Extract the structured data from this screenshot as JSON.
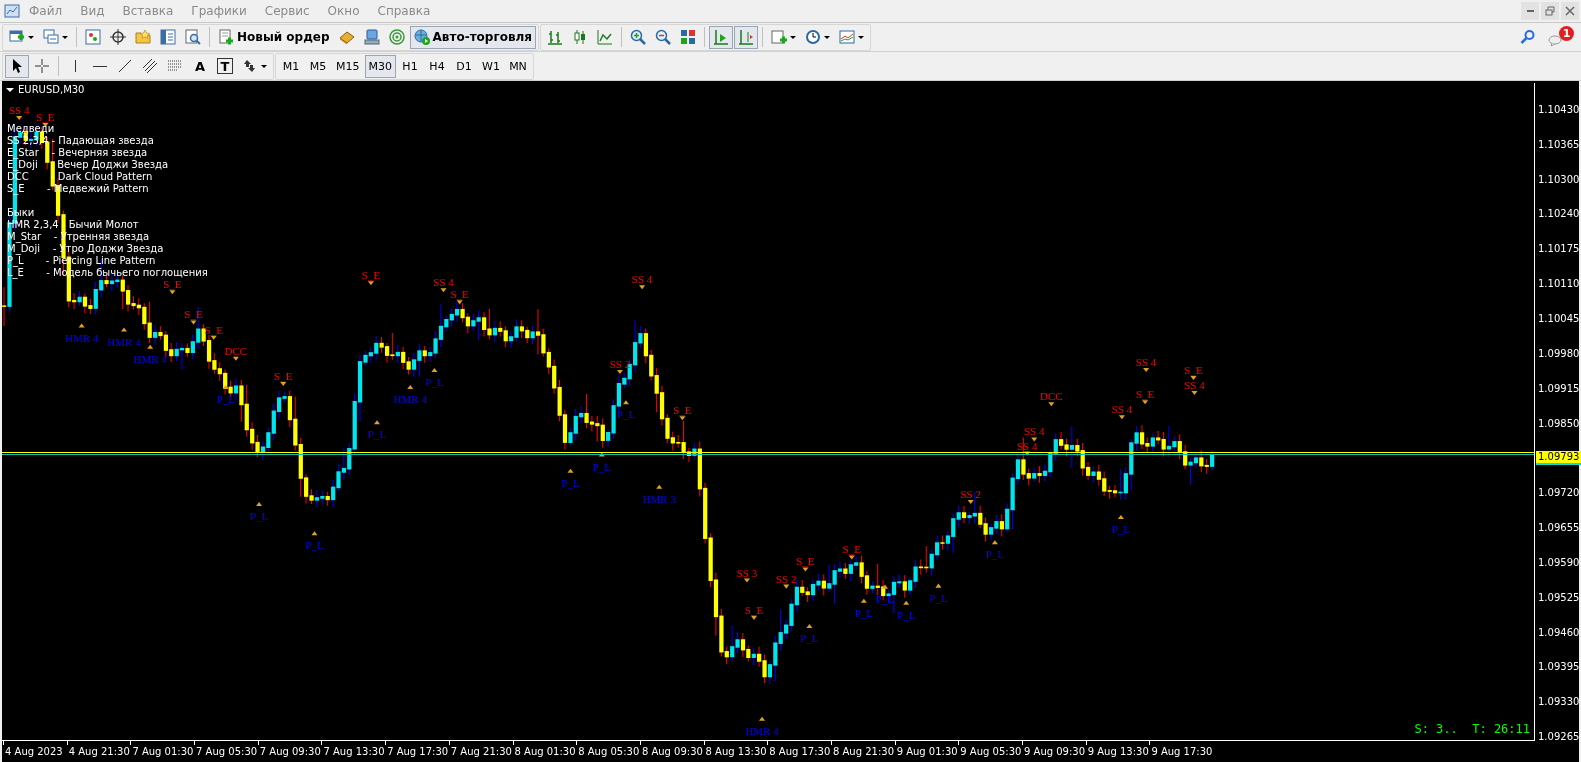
{
  "menu": [
    {
      "label": "Файл"
    },
    {
      "label": "Вид"
    },
    {
      "label": "Вставка"
    },
    {
      "label": "Графики"
    },
    {
      "label": "Сервис"
    },
    {
      "label": "Окно"
    },
    {
      "label": "Справка"
    }
  ],
  "toolbar": {
    "new_order_button": "Новый ордер",
    "autotrading_button": {
      "label": "Авто-торговля",
      "on": true
    },
    "notification_badge": "1"
  },
  "drawing_toolbar": {
    "text_tool": "A",
    "text_label_tool": "T"
  },
  "timeframes": [
    {
      "label": "M1",
      "selected": false
    },
    {
      "label": "M5",
      "selected": false
    },
    {
      "label": "M15",
      "selected": false
    },
    {
      "label": "M30",
      "selected": true
    },
    {
      "label": "H1",
      "selected": false
    },
    {
      "label": "H4",
      "selected": false
    },
    {
      "label": "D1",
      "selected": false
    },
    {
      "label": "W1",
      "selected": false
    },
    {
      "label": "MN",
      "selected": false
    }
  ],
  "chart": {
    "title": "EURUSD,M30",
    "legend": {
      "bears": {
        "title": "Медведи",
        "lines": [
          "SS 2,3,4 - Падающая звезда",
          "E_Star    - Вечерняя звезда",
          "E_Doji    - Вечер Доджи Звезда",
          "DCC       - Dark Cloud Pattern",
          "S_E       - Медвежий Pattern"
        ]
      },
      "bulls": {
        "title": "Быки",
        "lines": [
          "HMR 2,3,4 - Бычий Молот",
          "M_Star    - Утренняя звезда",
          "M_Doji    - Утро Доджи Звезда",
          "P_L       - Piercing Line Pattern",
          "L_E       - Модель бычьего поглощения"
        ]
      }
    },
    "pattern_labels": [
      {
        "label": "SS 4",
        "kind": "bearish"
      },
      {
        "label": "S_E",
        "kind": "bearish"
      },
      {
        "label": "S_E",
        "kind": "bearish"
      },
      {
        "label": "S_E",
        "kind": "bearish"
      },
      {
        "label": "S_E",
        "kind": "bearish"
      },
      {
        "label": "DCC",
        "kind": "bearish"
      },
      {
        "label": "S_E",
        "kind": "bearish"
      },
      {
        "label": "S_E",
        "kind": "bearish"
      },
      {
        "label": "SS 4",
        "kind": "bearish"
      },
      {
        "label": "S_E",
        "kind": "bearish"
      },
      {
        "label": "SS 4",
        "kind": "bearish"
      },
      {
        "label": "SS 2",
        "kind": "bearish"
      },
      {
        "label": "S_E",
        "kind": "bearish"
      },
      {
        "label": "SS 3",
        "kind": "bearish"
      },
      {
        "label": "S_E",
        "kind": "bearish"
      },
      {
        "label": "SS 2",
        "kind": "bearish"
      },
      {
        "label": "S_E",
        "kind": "bearish"
      },
      {
        "label": "S_E",
        "kind": "bearish"
      },
      {
        "label": "SS 2",
        "kind": "bearish"
      },
      {
        "label": "DCC",
        "kind": "bearish"
      },
      {
        "label": "SS 4",
        "kind": "bearish"
      },
      {
        "label": "SS 4",
        "kind": "bearish"
      },
      {
        "label": "SS 4",
        "kind": "bearish"
      },
      {
        "label": "S_E",
        "kind": "bearish"
      },
      {
        "label": "SS 4",
        "kind": "bearish"
      },
      {
        "label": "SS 4",
        "kind": "bearish"
      },
      {
        "label": "S_E",
        "kind": "bearish"
      },
      {
        "label": "HMR 4",
        "kind": "bullish"
      },
      {
        "label": "HMR 4",
        "kind": "bullish"
      },
      {
        "label": "HMR 4",
        "kind": "bullish"
      },
      {
        "label": "P_L",
        "kind": "bullish"
      },
      {
        "label": "P_L",
        "kind": "bullish"
      },
      {
        "label": "P_L",
        "kind": "bullish"
      },
      {
        "label": "P_L",
        "kind": "bullish"
      },
      {
        "label": "HMR 4",
        "kind": "bullish"
      },
      {
        "label": "P_L",
        "kind": "bullish"
      },
      {
        "label": "P_L",
        "kind": "bullish"
      },
      {
        "label": "P_L",
        "kind": "bullish"
      },
      {
        "label": "P_L",
        "kind": "bullish"
      },
      {
        "label": "HMR 3",
        "kind": "bullish"
      },
      {
        "label": "HMR 4",
        "kind": "bullish"
      },
      {
        "label": "P_L",
        "kind": "bullish"
      },
      {
        "label": "P_L",
        "kind": "bullish"
      },
      {
        "label": "P_L",
        "kind": "bullish"
      },
      {
        "label": "P_L",
        "kind": "bullish"
      },
      {
        "label": "P_L",
        "kind": "bullish"
      },
      {
        "label": "P_L",
        "kind": "bullish"
      },
      {
        "label": "P_L",
        "kind": "bullish"
      }
    ],
    "price_ticks": [
      "1.10430",
      "1.10365",
      "1.10300",
      "1.10240",
      "1.10175",
      "1.10110",
      "1.10045",
      "1.09980",
      "1.09915",
      "1.09850",
      "1.09720",
      "1.09655",
      "1.09590",
      "1.09525",
      "1.09460",
      "1.09395",
      "1.09330",
      "1.09265"
    ],
    "current_price": "1.09793",
    "time_labels": [
      "4 Aug 2023",
      "4 Aug 21:30",
      "7 Aug 01:30",
      "7 Aug 05:30",
      "7 Aug 09:30",
      "7 Aug 13:30",
      "7 Aug 17:30",
      "7 Aug 21:30",
      "8 Aug 01:30",
      "8 Aug 05:30",
      "8 Aug 09:30",
      "8 Aug 13:30",
      "8 Aug 17:30",
      "8 Aug 21:30",
      "9 Aug 01:30",
      "9 Aug 05:30",
      "9 Aug 09:30",
      "9 Aug 13:30",
      "9 Aug 17:30"
    ],
    "timer": "S: 3..  T: 26:11"
  }
}
